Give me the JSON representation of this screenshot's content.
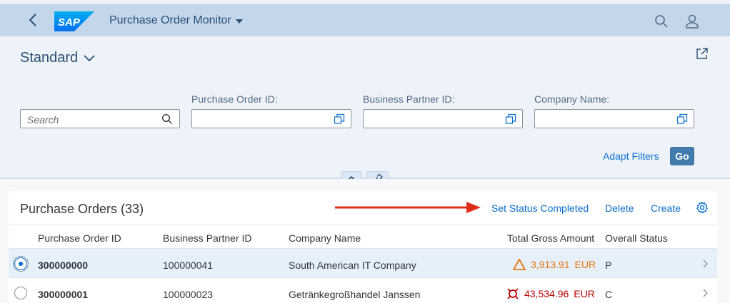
{
  "shell": {
    "back_icon": "back-icon",
    "logo_text": "SAP",
    "app_title": "Purchase Order Monitor",
    "brand_color": "#0070f2"
  },
  "header": {
    "variant_name": "Standard",
    "filters": {
      "search_placeholder": "Search",
      "po_id_label": "Purchase Order ID:",
      "bp_id_label": "Business Partner ID:",
      "company_label": "Company Name:"
    },
    "adapt_filters": "Adapt Filters",
    "go": "Go"
  },
  "table": {
    "title": "Purchase Orders (33)",
    "actions": {
      "set_status": "Set Status Completed",
      "delete": "Delete",
      "create": "Create"
    },
    "columns": [
      "Purchase Order ID",
      "Business Partner ID",
      "Company Name",
      "Total Gross Amount",
      "Overall Status"
    ],
    "rows": [
      {
        "po_id": "300000000",
        "bp_id": "100000041",
        "company": "South American IT Company",
        "amount": "3,913.91",
        "currency": "EUR",
        "status": "P",
        "amount_state": "warning",
        "amount_color": "#e9730c",
        "selected": true
      },
      {
        "po_id": "300000001",
        "bp_id": "100000023",
        "company": "Getränkegroßhandel Janssen",
        "amount": "43,534.96",
        "currency": "EUR",
        "status": "C",
        "amount_state": "error",
        "amount_color": "#bb0000",
        "selected": false
      }
    ]
  },
  "colors": {
    "shell_bg": "#c4d6ea",
    "header_bg": "#eef3f9",
    "link": "#0a6ed1",
    "go_button": "#427cac",
    "annotation_arrow": "#e02c1b"
  }
}
